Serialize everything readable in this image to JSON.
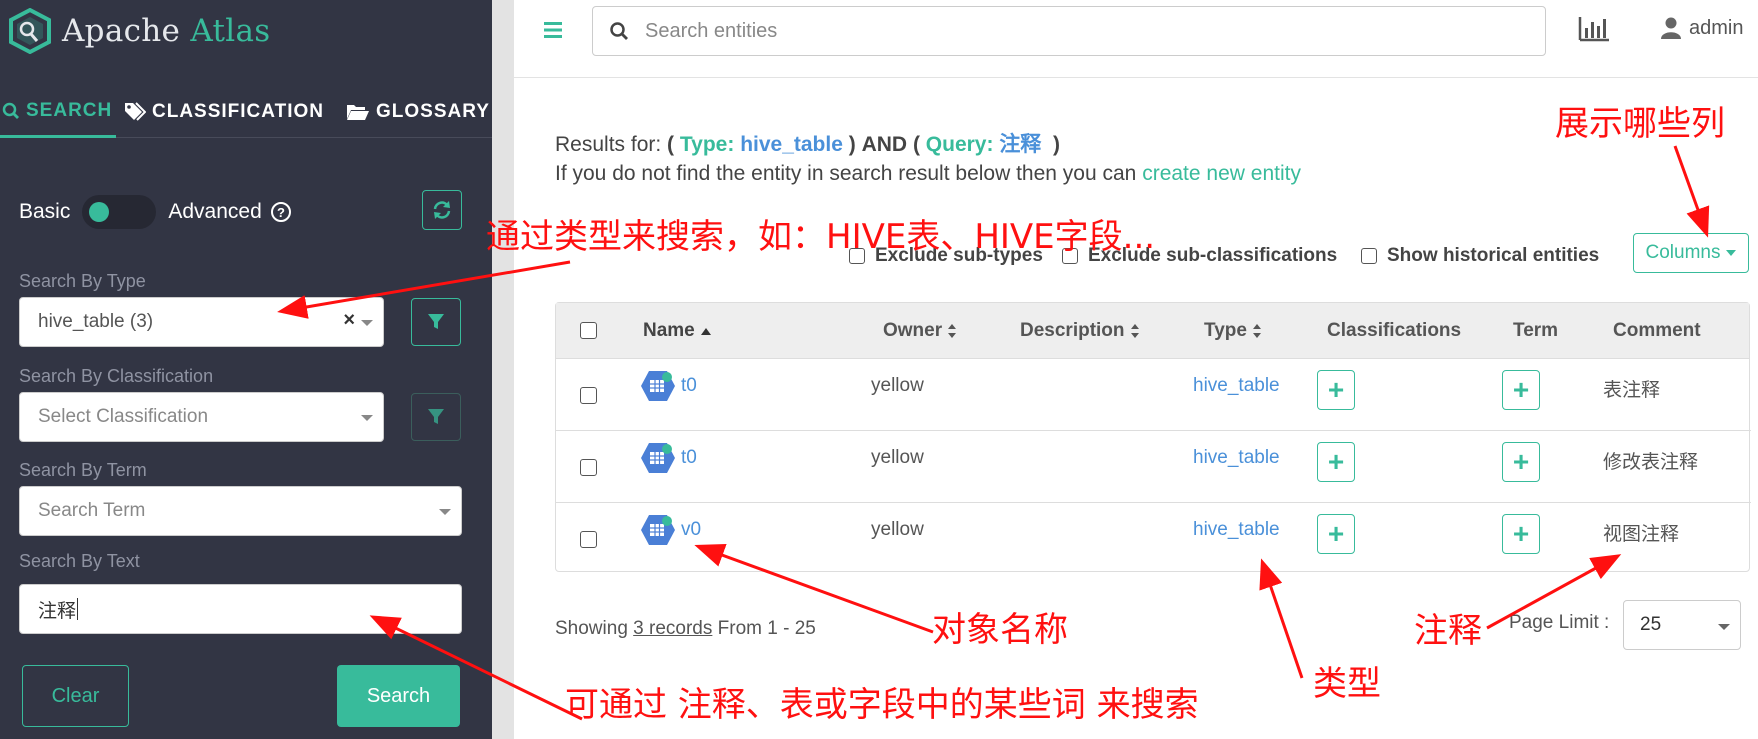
{
  "app": {
    "name_part1": "Apache",
    "name_part2": "Atlas"
  },
  "sidebar": {
    "tabs": [
      {
        "label": "SEARCH",
        "icon": "search-icon"
      },
      {
        "label": "CLASSIFICATION",
        "icon": "tags-icon"
      },
      {
        "label": "GLOSSARY",
        "icon": "folder-open-icon"
      }
    ],
    "toggle": {
      "basic": "Basic",
      "advanced": "Advanced",
      "mode": "basic"
    },
    "search_by_type": {
      "label": "Search By Type",
      "value": "hive_table (3)"
    },
    "search_by_classification": {
      "label": "Search By Classification",
      "placeholder": "Select Classification"
    },
    "search_by_term": {
      "label": "Search By Term",
      "placeholder": "Search Term"
    },
    "search_by_text": {
      "label": "Search By Text",
      "value": "注释"
    },
    "clear_label": "Clear",
    "search_label": "Search"
  },
  "header": {
    "search_placeholder": "Search entities",
    "user": "admin"
  },
  "main": {
    "results_prefix": "Results for:",
    "type_key": "Type:",
    "type_value": "hive_table",
    "and": "AND",
    "query_key": "Query:",
    "query_value": "注释",
    "hint_text": "If you do not find the entity in search result below then you can",
    "hint_link": "create new entity",
    "exclude_subtypes": "Exclude sub-types",
    "exclude_subclassifications": "Exclude sub-classifications",
    "show_historical": "Show historical entities",
    "columns_label": "Columns",
    "table": {
      "headers": {
        "name": "Name",
        "owner": "Owner",
        "description": "Description",
        "type": "Type",
        "classifications": "Classifications",
        "term": "Term",
        "comment": "Comment"
      },
      "rows": [
        {
          "name": "t0",
          "owner": "yellow",
          "type": "hive_table",
          "comment": "表注释"
        },
        {
          "name": "t0",
          "owner": "yellow",
          "type": "hive_table",
          "comment": "修改表注释"
        },
        {
          "name": "v0",
          "owner": "yellow",
          "type": "hive_table",
          "comment": "视图注释"
        }
      ]
    },
    "showing_prefix": "Showing",
    "showing_records": "3 records",
    "showing_suffix": "From 1 - 25",
    "page_limit_label": "Page Limit :",
    "page_limit_value": "25"
  },
  "annotations": {
    "columns_note": "展示哪些列",
    "type_note": "通过类型来搜索，如：HIVE表、HIVE字段...",
    "name_note": "对象名称",
    "comment_note": "注释",
    "kind_note": "类型",
    "text_note": "可通过 注释、表或字段中的某些词 来搜索"
  },
  "colors": {
    "accent": "#38bb9b",
    "sidebar_bg": "#323544",
    "link": "#4a90d9",
    "annotation": "#ff1010"
  }
}
